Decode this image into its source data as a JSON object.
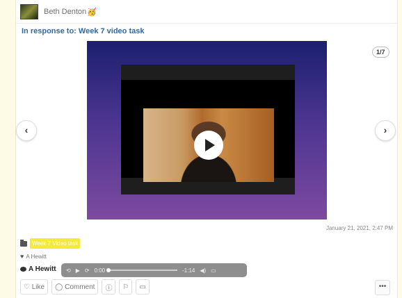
{
  "header": {
    "author": "Beth Denton",
    "emoji": "🥳"
  },
  "response": {
    "label": "In response to: Week 7 video task"
  },
  "media": {
    "counter": "1/7",
    "prev": "‹",
    "next": "›"
  },
  "post": {
    "timestamp": "January 21, 2021, 2:47 PM",
    "tag": "Week 7 Video task"
  },
  "likes": {
    "name": "A Hewitt"
  },
  "comment": {
    "author": "A Hewitt"
  },
  "player": {
    "time_current": "0:00",
    "time_remaining": "-1:14",
    "progress": 0
  },
  "actions": {
    "like": "Like",
    "comment": "Comment",
    "more": "•••"
  },
  "colors": {
    "link": "#2e6aa6",
    "tag_bg": "#f3ea3b",
    "media_top": "#1c1f6e",
    "media_bottom": "#7d4aa0"
  }
}
